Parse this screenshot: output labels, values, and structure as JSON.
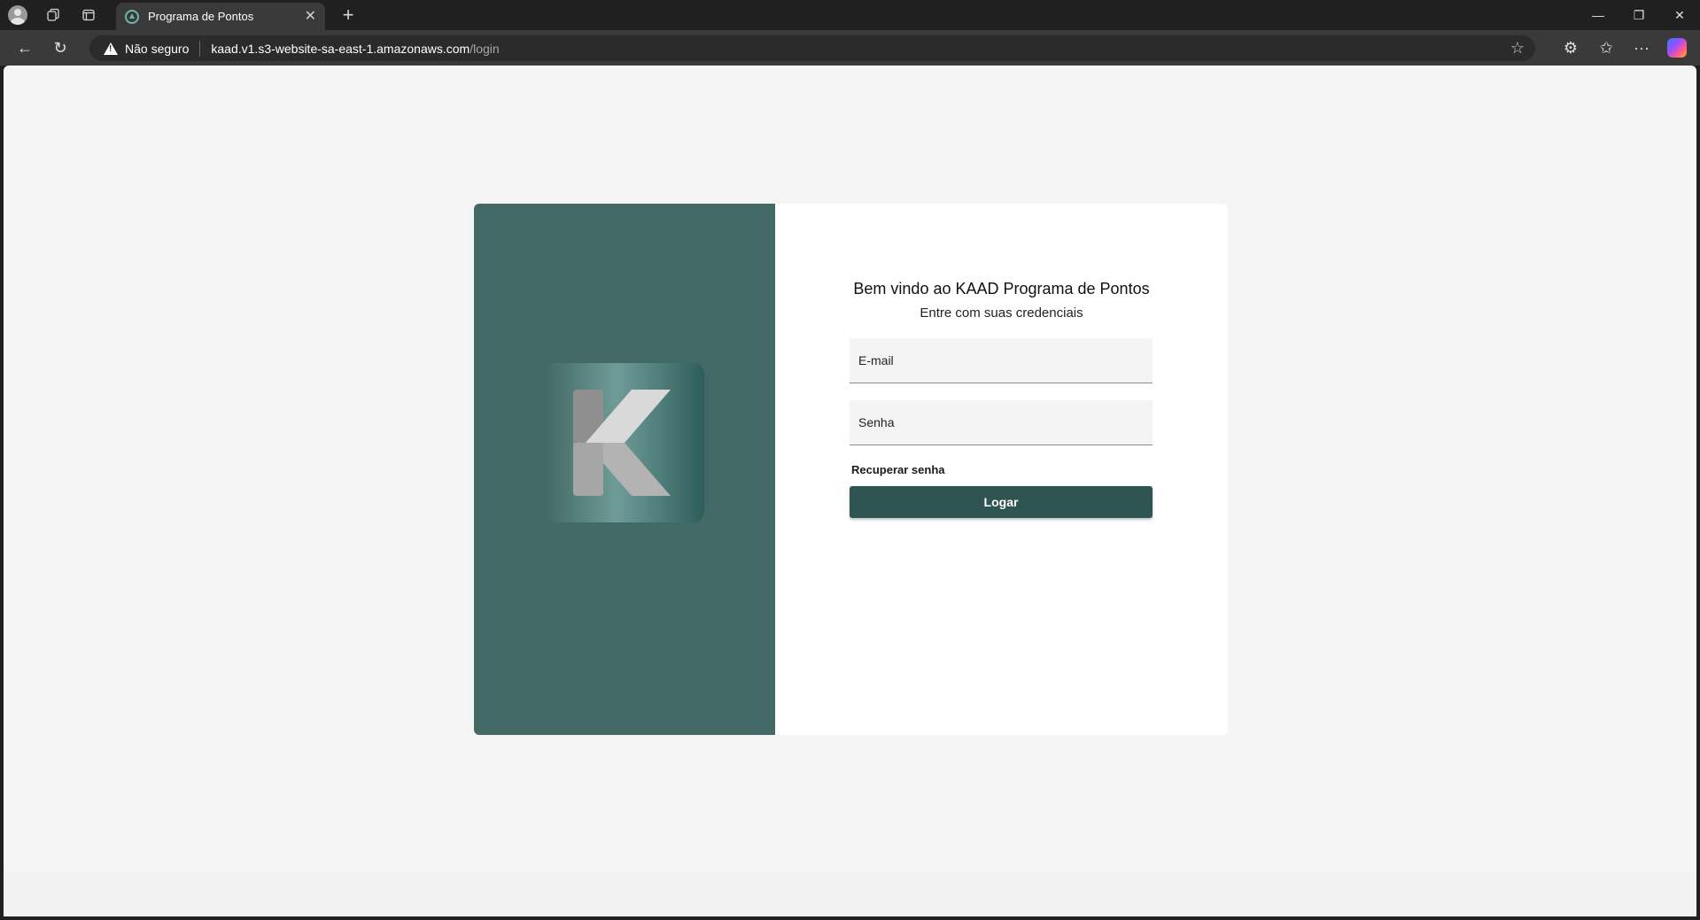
{
  "browser": {
    "tab": {
      "title": "Programa de Pontos"
    },
    "new_tab_glyph": "+",
    "close_tab_glyph": "✕",
    "address": {
      "security_label": "Não seguro",
      "host": "kaad.v1.s3-website-sa-east-1.amazonaws.com",
      "path": "/login"
    },
    "window_controls": {
      "minimize": "—",
      "restore": "❐",
      "close": "✕"
    },
    "icons": {
      "profile": "profile-avatar-icon",
      "workspaces": "workspaces-icon",
      "tab_actions": "vertical-tabs-icon",
      "back": "back-arrow-icon",
      "refresh": "refresh-icon",
      "warning": "warning-icon",
      "favorite": "star-icon",
      "extensions": "extensions-icon",
      "favorites": "favorites-icon",
      "more": "more-icon",
      "copilot": "copilot-icon"
    },
    "glyphs": {
      "back": "←",
      "refresh": "↻",
      "star": "☆",
      "extensions": "⚙",
      "favorites": "✩",
      "more": "···"
    }
  },
  "page": {
    "welcome_title": "Bem vindo ao KAAD Programa de Pontos",
    "welcome_subtitle": "Entre com suas credenciais",
    "email": {
      "placeholder": "E-mail",
      "value": ""
    },
    "password": {
      "placeholder": "Senha",
      "value": ""
    },
    "recover_link": "Recuperar senha",
    "login_button": "Logar",
    "colors": {
      "brand_panel": "#426965",
      "button": "#2f5552",
      "background": "#f5f5f5"
    }
  }
}
